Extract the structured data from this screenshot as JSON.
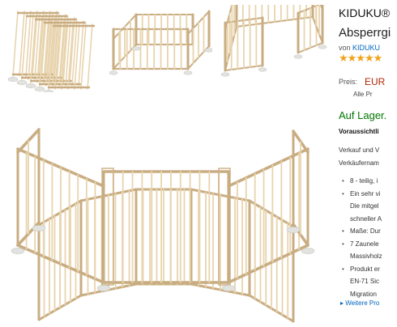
{
  "product": {
    "title_line1": "KIDUKU®",
    "title_line2": "Absperrgi",
    "by_prefix": "von",
    "brand_link": "KIDUKU",
    "rating_stars": "★★★★★",
    "price_label": "Preis:",
    "price": "EUR",
    "price_sub": "Alle Pr",
    "stock": "Auf Lager.",
    "delivery": "Voraussichtli",
    "sold_by_1": "Verkauf und V",
    "sold_by_2": "Verkäufernam",
    "bullets": [
      "8 - teilig, i",
      "Ein sehr vi",
      "Die mitgel",
      "schneller A",
      "Maße: Dur",
      "7 Zaunele",
      "Massivholz",
      "Produkt er",
      "EN-71 Sic",
      "Migration"
    ],
    "more_link": "▸ Weitere Pro"
  },
  "gallery": {
    "thumbnails": [
      "folded-playpen",
      "rectangular-playpen",
      "open-playpen"
    ],
    "main_image": "octagonal-playpen"
  },
  "colors": {
    "wood": "#e8d4ae",
    "wood_dark": "#c9ad82",
    "price": "#b12704",
    "stock": "#007600",
    "link": "#0066c0",
    "star": "#f0a41c"
  }
}
